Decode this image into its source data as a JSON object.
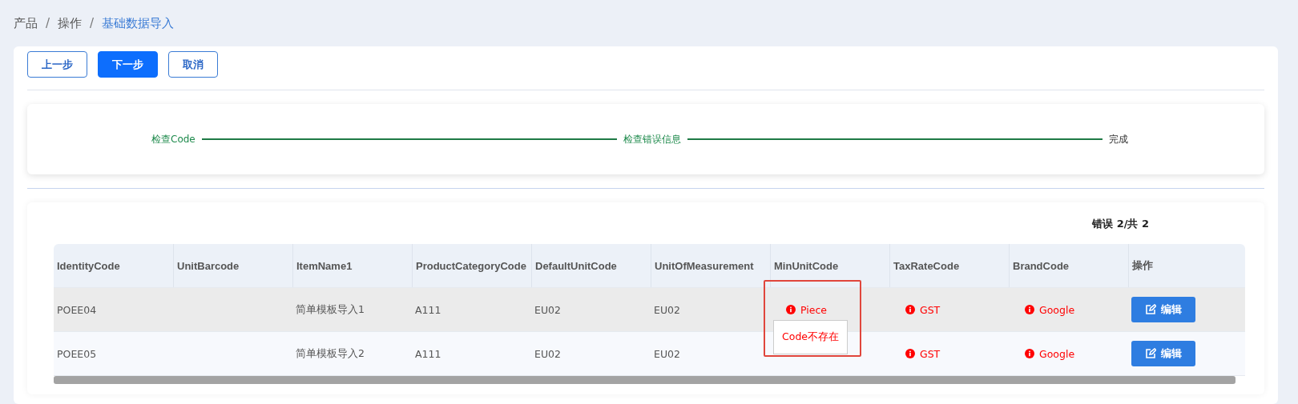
{
  "breadcrumb_separator": "/",
  "breadcrumb": [
    {
      "label": "产品",
      "current": false
    },
    {
      "label": "操作",
      "current": false
    },
    {
      "label": "基础数据导入",
      "current": true
    }
  ],
  "buttons": [
    {
      "label": "上一步",
      "primary": false
    },
    {
      "label": "下一步",
      "primary": true
    },
    {
      "label": "取消",
      "primary": false
    }
  ],
  "steps": [
    {
      "label": "检查Code",
      "done": true
    },
    {
      "label": "检查错误信息",
      "done": true
    },
    {
      "label": "完成",
      "done": false
    }
  ],
  "error_count": "错误 2/共 2",
  "table": {
    "columns": [
      "IdentityCode",
      "UnitBarcode",
      "ItemName1",
      "ProductCategoryCode",
      "DefaultUnitCode",
      "UnitOfMeasurement",
      "MinUnitCode",
      "TaxRateCode",
      "BrandCode",
      "操作"
    ],
    "rows": [
      {
        "highlighted": true,
        "cells": [
          {
            "kind": "plain",
            "text": "POEE04"
          },
          {
            "kind": "empty"
          },
          {
            "kind": "plain",
            "text": "简单模板导入1"
          },
          {
            "kind": "plain",
            "text": "A111"
          },
          {
            "kind": "plain",
            "text": "EU02"
          },
          {
            "kind": "plain",
            "text": "EU02"
          },
          {
            "kind": "error",
            "text": "Piece",
            "tooltip": "Code不存在"
          },
          {
            "kind": "error",
            "text": "GST"
          },
          {
            "kind": "error",
            "text": "Google"
          },
          {
            "kind": "action",
            "text": "编辑"
          }
        ]
      },
      {
        "highlighted": false,
        "cells": [
          {
            "kind": "plain",
            "text": "POEE05"
          },
          {
            "kind": "empty"
          },
          {
            "kind": "plain",
            "text": "简单模板导入2"
          },
          {
            "kind": "plain",
            "text": "A111"
          },
          {
            "kind": "plain",
            "text": "EU02"
          },
          {
            "kind": "plain",
            "text": "EU02"
          },
          {
            "kind": "empty"
          },
          {
            "kind": "error",
            "text": "GST"
          },
          {
            "kind": "error",
            "text": "Google"
          },
          {
            "kind": "action",
            "text": "编辑"
          }
        ]
      }
    ]
  }
}
